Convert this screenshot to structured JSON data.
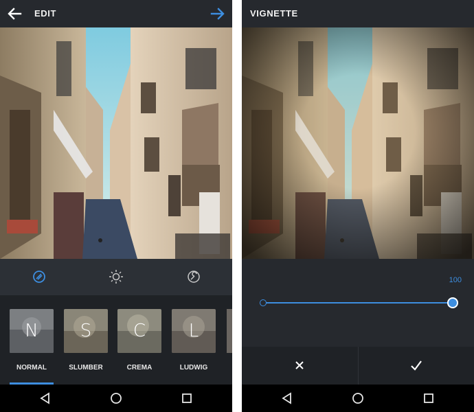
{
  "left_screen": {
    "title": "EDIT",
    "back_icon": "arrow-left-icon",
    "next_icon": "arrow-right-icon",
    "tools": [
      {
        "name": "lux-icon"
      },
      {
        "name": "brightness-icon"
      },
      {
        "name": "wrench-icon"
      }
    ],
    "filters": [
      {
        "letter": "N",
        "label": "NORMAL",
        "selected": true
      },
      {
        "letter": "S",
        "label": "SLUMBER",
        "selected": false
      },
      {
        "letter": "C",
        "label": "CREMA",
        "selected": false
      },
      {
        "letter": "L",
        "label": "LUDWIG",
        "selected": false
      }
    ]
  },
  "right_screen": {
    "title": "VIGNETTE",
    "slider": {
      "value": "100",
      "level": 1.0
    },
    "cancel_icon": "close-icon",
    "confirm_icon": "check-icon"
  },
  "navbar": {
    "back": "nav-back-icon",
    "home": "nav-home-icon",
    "recents": "nav-recents-icon"
  },
  "colors": {
    "accent": "#3d8ee0",
    "bar": "#26292e",
    "dark": "#1f2226"
  }
}
